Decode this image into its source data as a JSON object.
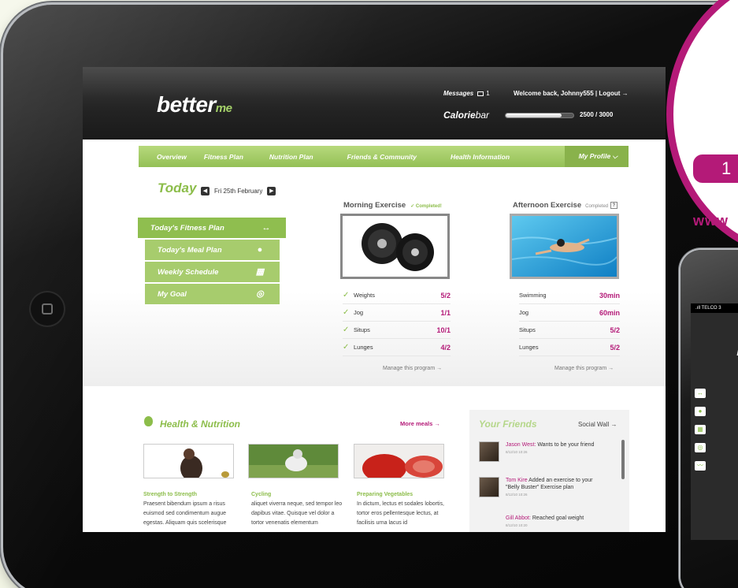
{
  "app": {
    "brand": "better",
    "brand_suffix": "me"
  },
  "header": {
    "messages_label": "Messages",
    "messages_count": "1",
    "welcome": "Welcome back, Johnny555 | Logout →",
    "calorie_label_bold": "Calorie",
    "calorie_label_rest": "bar",
    "calorie_value": "2500 / 3000",
    "calorie_progress": 0.83
  },
  "nav": {
    "items": [
      "Overview",
      "Fitness Plan",
      "Nutrition Plan",
      "Friends & Community",
      "Health Information"
    ],
    "profile": "My Profile ⌵"
  },
  "today": {
    "title": "Today",
    "date": "Fri 25th February"
  },
  "menu": {
    "items": [
      "Today's Fitness Plan",
      "Today's Meal Plan",
      "Weekly Schedule",
      "My Goal"
    ]
  },
  "morning": {
    "title": "Morning Exercise",
    "status": "✓ Completed!",
    "rows": [
      {
        "name": "Weights",
        "num": "5",
        "den": "2"
      },
      {
        "name": "Jog",
        "num": "1",
        "den": "1"
      },
      {
        "name": "Situps",
        "num": "10",
        "den": "1"
      },
      {
        "name": "Lunges",
        "num": "4",
        "den": "2"
      }
    ],
    "manage": "Manage this program →"
  },
  "afternoon": {
    "title": "Afternoon Exercise",
    "status": "Completed",
    "status_box": "?",
    "rows": [
      {
        "name": "Swimming",
        "value": "30min"
      },
      {
        "name": "Jog",
        "value": "60min"
      },
      {
        "name": "Situps",
        "num": "5",
        "den": "2"
      },
      {
        "name": "Lunges",
        "num": "5",
        "den": "2"
      }
    ],
    "manage": "Manage this program →"
  },
  "health": {
    "title": "Health & Nutrition",
    "more": "More meals →",
    "articles": [
      {
        "title": "Strength to Strength",
        "text": "Praesent bibendum ipsum a risus euismod sed condimentum augue egestas. Aliquam quis scelerisque"
      },
      {
        "title": "Cycling",
        "text": "aliquet viverra neque, sed tempor leo dapibus vitae. Quisque vel dolor a tortor venenatis elementum"
      },
      {
        "title": "Preparing Vegetables",
        "text": "In dictum, lectus et sodales lobortis, tortor eros pellentesque lectus, at facilisis urna lacus id"
      }
    ]
  },
  "friends": {
    "title": "Your Friends",
    "social": "Social Wall →",
    "items": [
      {
        "name": "Jason West:",
        "text": " Wants to be your friend",
        "date": "8/12/10 10:26"
      },
      {
        "name": "Tom Kire",
        "text": " Added an exercise to your \"Belly Buster\" Exercise plan",
        "date": "8/12/10 10:26"
      },
      {
        "name": "Gill Abbot:",
        "text": " Reached goal weight",
        "date": "8/12/10 10:20"
      }
    ]
  },
  "badge": {
    "tab_text": "1",
    "www": "www"
  },
  "phone": {
    "carrier": ".ıll TELCO 3",
    "logo": "b"
  },
  "colors": {
    "accent_green": "#8cbd4a",
    "accent_magenta": "#b41a78",
    "header_dark": "#232323"
  }
}
